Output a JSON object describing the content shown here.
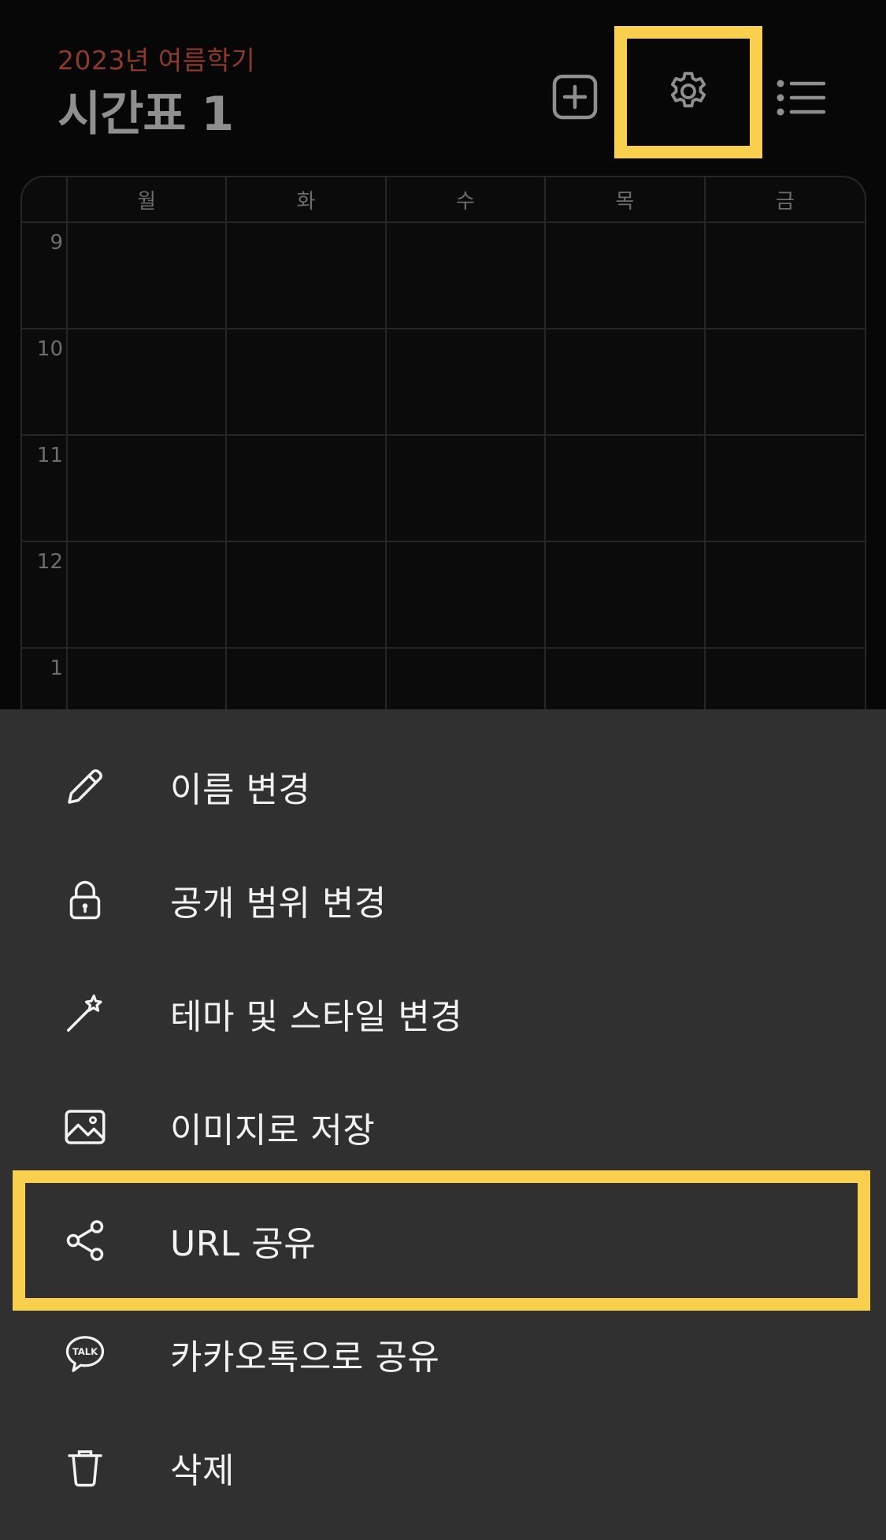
{
  "header": {
    "semester": "2023년 여름학기",
    "title": "시간표 1"
  },
  "timetable": {
    "days": [
      "월",
      "화",
      "수",
      "목",
      "금"
    ],
    "hours": [
      "9",
      "10",
      "11",
      "12",
      "1"
    ]
  },
  "menu": {
    "items": [
      {
        "label": "이름 변경",
        "icon": "pencil-icon"
      },
      {
        "label": "공개 범위 변경",
        "icon": "lock-icon"
      },
      {
        "label": "테마 및 스타일 변경",
        "icon": "magic-wand-icon"
      },
      {
        "label": "이미지로 저장",
        "icon": "image-icon"
      },
      {
        "label": "URL 공유",
        "icon": "share-icon"
      },
      {
        "label": "카카오톡으로 공유",
        "icon": "kakaotalk-icon"
      },
      {
        "label": "삭제",
        "icon": "trash-icon"
      }
    ],
    "kakao_icon_text": "TALK"
  },
  "colors": {
    "highlight": "#f9cf4e",
    "semester_text": "#8c3a2b",
    "sheet_background": "#303030",
    "page_background": "#070707"
  }
}
